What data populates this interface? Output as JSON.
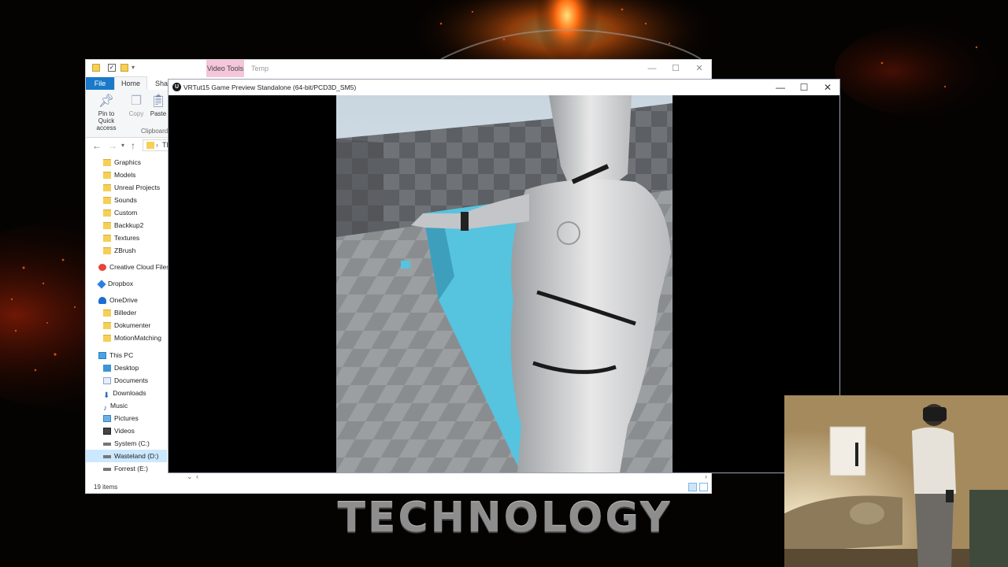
{
  "desktop": {
    "banner_text": "TECHNOLOGY"
  },
  "explorer": {
    "context_tab": "Video Tools",
    "title": "Temp",
    "ribbon_tabs": [
      "File",
      "Home",
      "Share"
    ],
    "ribbon_buttons": {
      "pin_label": "Pin to Quick access",
      "copy_label": "Copy",
      "paste_label": "Paste",
      "group_label": "Clipboard"
    },
    "address_text": "Th",
    "nav": {
      "graphics": "Graphics",
      "models": "Models",
      "unreal": "Unreal Projects",
      "sounds": "Sounds",
      "custom": "Custom",
      "backup2": "Backkup2",
      "textures": "Textures",
      "zbrush": "ZBrush",
      "creative_cloud": "Creative Cloud Files",
      "dropbox": "Dropbox",
      "onedrive": "OneDrive",
      "billeder": "Billeder",
      "dokumenter": "Dokumenter",
      "motion": "MotionMatching",
      "this_pc": "This PC",
      "desktop": "Desktop",
      "documents": "Documents",
      "downloads": "Downloads",
      "music": "Music",
      "pictures": "Pictures",
      "videos": "Videos",
      "system_c": "System (C:)",
      "wasteland_d": "Wasteland (D:)",
      "forrest_e": "Forrest (E:)"
    },
    "status_text": "19 items"
  },
  "game_window": {
    "title": "VRTut15 Game Preview Standalone (64-bit/PCD3D_SM5)",
    "controls": {
      "minimize": "—",
      "maximize": "☐",
      "close": "✕"
    }
  },
  "icons": {
    "pin": "pin-icon",
    "copy": "copy-icon",
    "paste": "paste-icon",
    "back": "back-arrow-icon",
    "forward": "forward-arrow-icon",
    "up": "up-arrow-icon",
    "ue": "unreal-engine-logo-icon"
  },
  "colors": {
    "file_tab": "#1979ca",
    "context_tab": "#f5c5da",
    "selected_nav": "#cce8ff",
    "cube_cyan": "#56c3df"
  }
}
